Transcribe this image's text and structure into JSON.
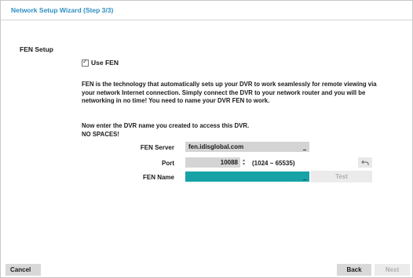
{
  "window": {
    "title": "Network Setup Wizard (Step 3/3)"
  },
  "section": {
    "title": "FEN Setup"
  },
  "use_fen": {
    "label": "Use FEN",
    "checked": true
  },
  "description": {
    "line1": "FEN is the technology that automatically sets up your DVR to work seamlessly for remote viewing via",
    "line2": "your network Internet connection. Simply connect the DVR to your network router and you will be",
    "line3": "networking in no time! You need to name your DVR FEN to work."
  },
  "instruction": {
    "line1": "Now enter the DVR name you created to access this DVR.",
    "line2": "NO SPACES!"
  },
  "form": {
    "fen_server_label": "FEN Server",
    "fen_server_value": "fen.idisglobal.com",
    "port_label": "Port",
    "port_value": "10088",
    "port_range": "(1024 ~ 65535)",
    "fen_name_label": "FEN Name",
    "fen_name_value": "",
    "test_label": "Test"
  },
  "footer": {
    "cancel_label": "Cancel",
    "back_label": "Back",
    "next_label": "Next"
  },
  "colors": {
    "title": "#2f8fc4",
    "fen_name_field": "#17a2a6",
    "field_bg": "#d4d4d4"
  },
  "icons": {
    "undo": "undo-icon",
    "spin_up": "spin-up-icon",
    "spin_down": "spin-down-icon",
    "checkmark": "checkmark-icon"
  }
}
